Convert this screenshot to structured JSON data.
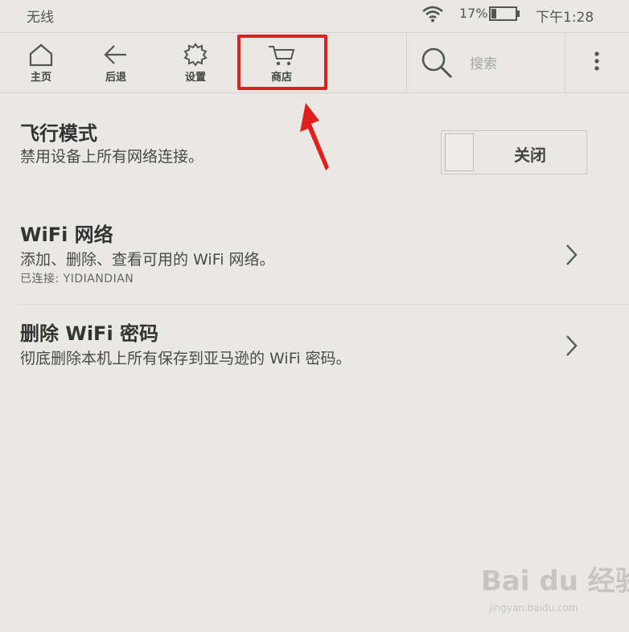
{
  "status_bar": {
    "network": "无线",
    "battery": "17%",
    "time": "下午1:28"
  },
  "toolbar": {
    "home_label": "主页",
    "back_label": "后退",
    "settings_label": "设置",
    "store_label": "商店",
    "search_placeholder": "搜索"
  },
  "settings": {
    "airplane": {
      "title": "飞行模式",
      "desc": "禁用设备上所有网络连接。",
      "toggle_label": "关闭"
    },
    "wifi": {
      "title": "WiFi 网络",
      "desc": "添加、删除、查看可用的 WiFi 网络。",
      "connected": "已连接: YIDIANDIAN"
    },
    "delete_wifi": {
      "title": "删除 WiFi 密码",
      "desc": "彻底删除本机上所有保存到亚马逊的 WiFi 密码。"
    }
  },
  "watermark": {
    "logo": "Bai du 经验",
    "site": "jingyan.baidu.com"
  },
  "colors": {
    "highlight": "#e0201c",
    "background": "#e9e8e5"
  }
}
